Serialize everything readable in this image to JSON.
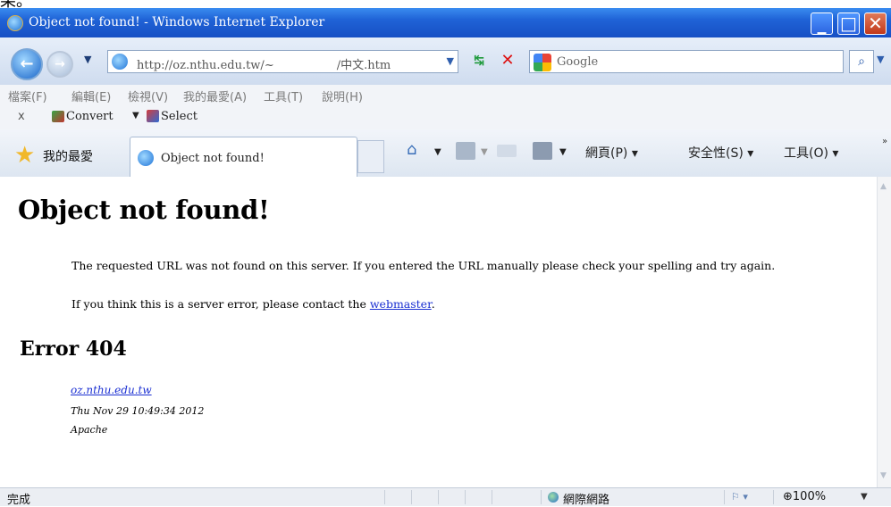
{
  "clipped_text": "果。",
  "window": {
    "title": "Object not found! - Windows Internet Explorer"
  },
  "address_bar": {
    "url_prefix": "http://oz.nthu.edu.tw/~",
    "url_suffix": "/中文.htm",
    "search_placeholder": "Google"
  },
  "menu": [
    "檔案(F)",
    "編輯(E)",
    "檢視(V)",
    "我的最愛(A)",
    "工具(T)",
    "說明(H)"
  ],
  "command_bar": {
    "close": "x",
    "convert": "Convert",
    "select": "Select"
  },
  "favorites_bar": {
    "favorites_label": "我的最愛",
    "tab_label": "Object not found!",
    "page_menu": "網頁(P)",
    "safety_menu": "安全性(S)",
    "tools_menu": "工具(O)"
  },
  "content": {
    "heading": "Object not found!",
    "message": "The requested URL was not found on this server. If you entered the URL manually please check your spelling and try again.",
    "contact_prefix": "If you think this is a server error, please contact the ",
    "contact_link": "webmaster",
    "contact_suffix": ".",
    "error_heading": "Error 404",
    "server_host": "oz.nthu.edu.tw",
    "timestamp": "Thu Nov 29 10:49:34 2012",
    "server_software": "Apache"
  },
  "status_bar": {
    "status": "完成",
    "zone": "網際網路",
    "zoom": "100%"
  },
  "colors": {
    "title_bar": "#1f62d6",
    "link": "#1a2fd2",
    "close_button": "#c2391a"
  }
}
